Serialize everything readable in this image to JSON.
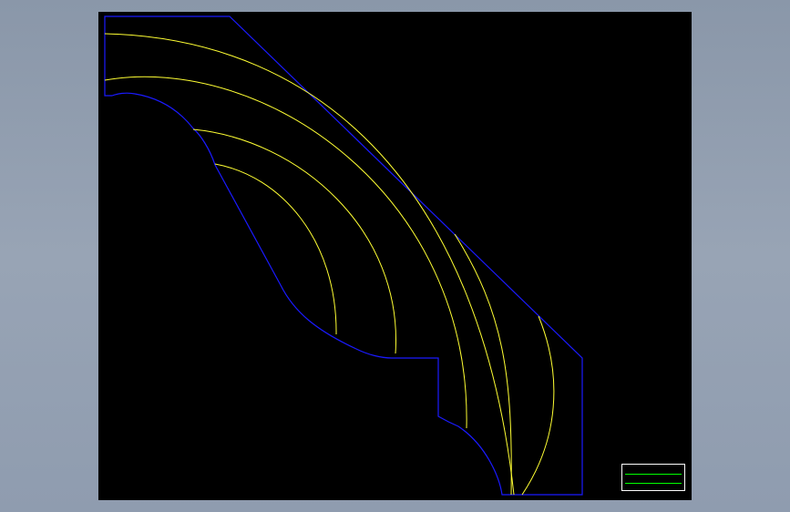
{
  "viewport": {
    "background_color": "#000000",
    "frame_color": "#8c99ab"
  },
  "drawing": {
    "outline_color": "#1a1aff",
    "arc_color": "#ffff33"
  },
  "title_block": {
    "border_color": "#ffffff",
    "text_color": "#00ff00",
    "lines": [
      "",
      "",
      "",
      "",
      ""
    ]
  }
}
